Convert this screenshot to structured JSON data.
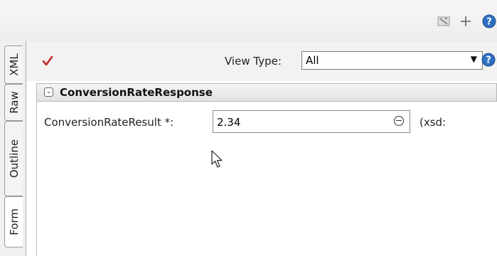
{
  "toolbar": {
    "icons": [
      "clear-icon",
      "add-icon",
      "help-icon"
    ]
  },
  "side_tabs": [
    {
      "label": "XML",
      "active": false
    },
    {
      "label": "Raw",
      "active": false
    },
    {
      "label": "Outline",
      "active": false
    },
    {
      "label": "Form",
      "active": true
    }
  ],
  "view": {
    "status_icon": "checkmark-icon",
    "status_color": "#c0282b",
    "type_label": "View Type:",
    "type_value": "All"
  },
  "panel": {
    "title": "ConversionRateResponse",
    "field_label": "ConversionRateResult *:",
    "field_value": "2.34",
    "type_hint": "(xsd:"
  }
}
